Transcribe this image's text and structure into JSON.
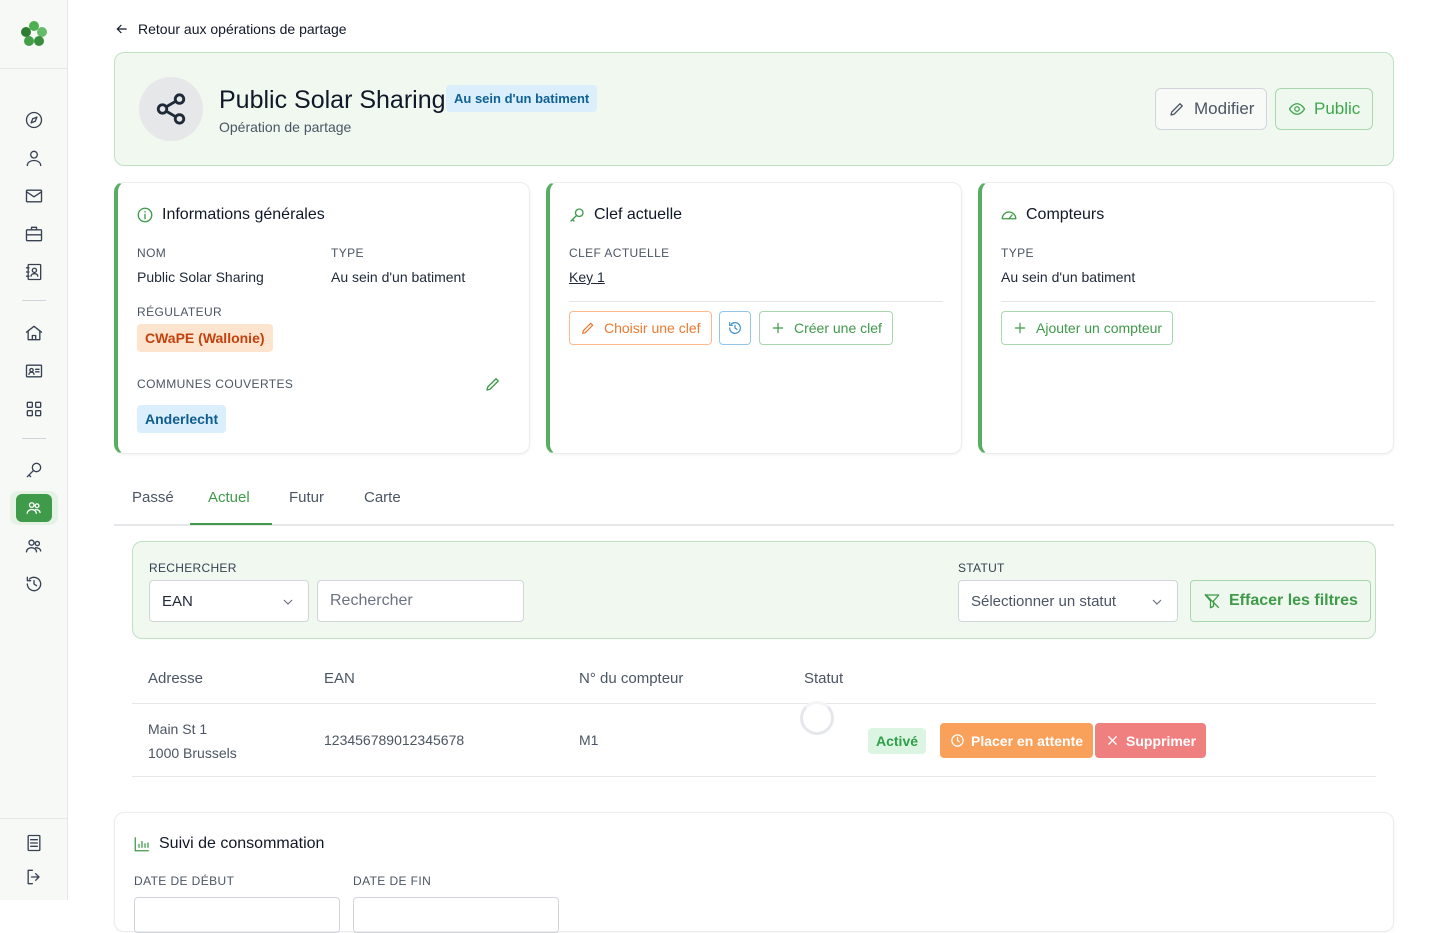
{
  "back": {
    "label": "Retour aux opérations de partage"
  },
  "hero": {
    "title": "Public Solar Sharing",
    "badge": "Au sein d'un batiment",
    "subtitle": "Opération de partage",
    "modify_label": "Modifier",
    "public_label": "Public"
  },
  "general": {
    "title": "Informations générales",
    "name_label": "NOM",
    "name_value": "Public Solar Sharing",
    "type_label": "TYPE",
    "type_value": "Au sein d'un batiment",
    "regulator_label": "RÉGULATEUR",
    "regulator_value": "CWaPE (Wallonie)",
    "communes_label": "COMMUNES COUVERTES",
    "communes": [
      "Anderlecht"
    ]
  },
  "key": {
    "title": "Clef actuelle",
    "current_label": "CLEF ACTUELLE",
    "current_value": "Key 1",
    "choose_label": "Choisir une clef",
    "create_label": "Créer une clef"
  },
  "meters": {
    "title": "Compteurs",
    "type_label": "TYPE",
    "type_value": "Au sein d'un batiment",
    "add_label": "Ajouter un compteur"
  },
  "tabs": [
    {
      "label": "Passé"
    },
    {
      "label": "Actuel",
      "active": true
    },
    {
      "label": "Futur"
    },
    {
      "label": "Carte"
    }
  ],
  "filters": {
    "search_label": "RECHERCHER",
    "search_field": "EAN",
    "search_placeholder": "Rechercher",
    "status_label": "STATUT",
    "status_placeholder": "Sélectionner un statut",
    "clear_label": "Effacer les filtres"
  },
  "table": {
    "headers": [
      "Adresse",
      "EAN",
      "N° du compteur",
      "Statut"
    ],
    "rows": [
      {
        "address_line1": "Main St 1",
        "address_line2": "1000 Brussels",
        "ean": "123456789012345678",
        "meter": "M1",
        "status": "Activé",
        "wait_label": "Placer en attente",
        "delete_label": "Supprimer"
      }
    ]
  },
  "consumption": {
    "title": "Suivi de consommation",
    "start_label": "DATE DE DÉBUT",
    "end_label": "DATE DE FIN"
  },
  "colors": {
    "accent": "#3f9a4a",
    "regulator_bg": "#fde4cf",
    "commune_bg": "#dbeefb",
    "wait": "#f9a15b",
    "delete": "#f08080"
  }
}
